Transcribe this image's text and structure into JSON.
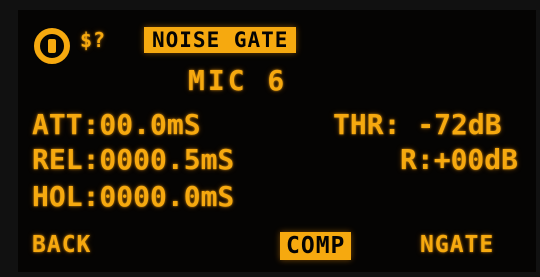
{
  "display": {
    "status_flag": "$?",
    "title": "NOISE GATE",
    "channel": "MIC 6",
    "params": {
      "attack": "ATT:00.0mS",
      "threshold": "THR: -72dB",
      "release": "REL:0000.5mS",
      "ratio": "R:+00dB",
      "hold": "HOL:0000.0mS"
    },
    "soft_keys": {
      "back": "BACK",
      "comp": "COMP",
      "ngate": "NGATE"
    },
    "icons": {
      "power": "power-icon"
    },
    "colors": {
      "background": "#050403",
      "text": "#f6a90f"
    }
  }
}
